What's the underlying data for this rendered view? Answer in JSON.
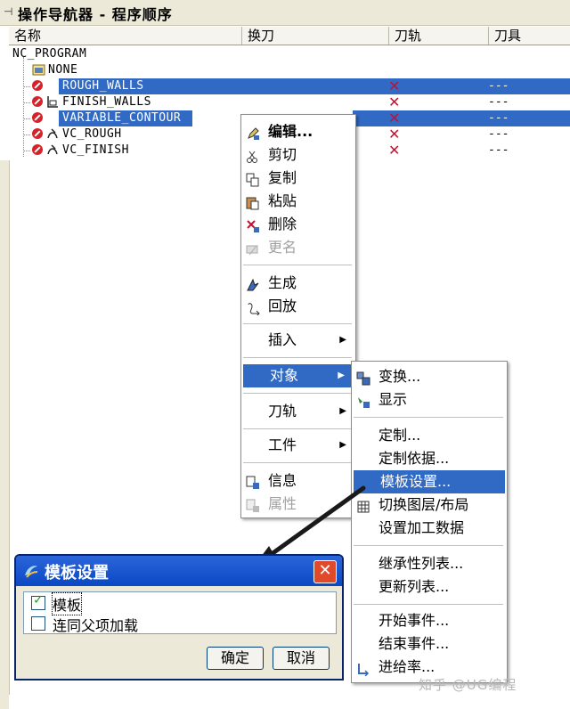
{
  "navigator": {
    "title": "操作导航器 - 程序顺序",
    "columns": [
      "名称",
      "换刀",
      "刀轨",
      "刀具"
    ]
  },
  "tree": {
    "root": "NC_PROGRAM",
    "none_node": "NONE",
    "operations": [
      {
        "name": "ROUGH_WALLS",
        "selected": true,
        "toolpath": "---"
      },
      {
        "name": "FINISH_WALLS",
        "selected": false,
        "toolpath": "---"
      },
      {
        "name": "VARIABLE_CONTOUR",
        "selected": true,
        "toolpath": "---"
      },
      {
        "name": "VC_ROUGH",
        "selected": false,
        "toolpath": "---"
      },
      {
        "name": "VC_FINISH",
        "selected": false,
        "toolpath": "---"
      }
    ]
  },
  "context_menu": {
    "items": [
      {
        "label": "编辑...",
        "icon": "edit-icon",
        "bold": true
      },
      {
        "label": "剪切",
        "icon": "cut-icon"
      },
      {
        "label": "复制",
        "icon": "copy-icon"
      },
      {
        "label": "粘贴",
        "icon": "paste-icon"
      },
      {
        "label": "删除",
        "icon": "delete-icon"
      },
      {
        "label": "更名",
        "icon": "rename-icon",
        "disabled": true
      },
      {
        "label": "生成",
        "icon": "generate-icon"
      },
      {
        "label": "回放",
        "icon": "replay-icon"
      },
      {
        "label": "插入",
        "submenu": true
      },
      {
        "label": "对象",
        "submenu": true,
        "highlighted": true
      },
      {
        "label": "刀轨",
        "submenu": true
      },
      {
        "label": "工件",
        "submenu": true
      },
      {
        "label": "信息",
        "icon": "info-icon"
      },
      {
        "label": "属性",
        "icon": "properties-icon",
        "disabled": true
      }
    ]
  },
  "object_submenu": {
    "items": [
      {
        "label": "变换...",
        "icon": "transform-icon"
      },
      {
        "label": "显示",
        "icon": "display-icon"
      },
      {
        "label": "定制..."
      },
      {
        "label": "定制依据..."
      },
      {
        "label": "模板设置...",
        "highlighted": true
      },
      {
        "label": "切换图层/布局",
        "icon": "layer-icon"
      },
      {
        "label": "设置加工数据"
      },
      {
        "label": "继承性列表..."
      },
      {
        "label": "更新列表..."
      },
      {
        "label": "开始事件..."
      },
      {
        "label": "结束事件..."
      },
      {
        "label": "进给率...",
        "icon": "feedrate-icon"
      }
    ]
  },
  "dialog": {
    "title": "模板设置",
    "checkbox_template": "模板",
    "checkbox_template_checked": true,
    "checkbox_parent": "连同父项加载",
    "checkbox_parent_checked": false,
    "ok_label": "确定",
    "cancel_label": "取消"
  },
  "watermark": "知乎 @UG编程",
  "colors": {
    "selection": "#316ac5",
    "dialog_title": "#0a48c4",
    "panel_bg": "#ece9d8",
    "red_x": "#c8102e"
  }
}
